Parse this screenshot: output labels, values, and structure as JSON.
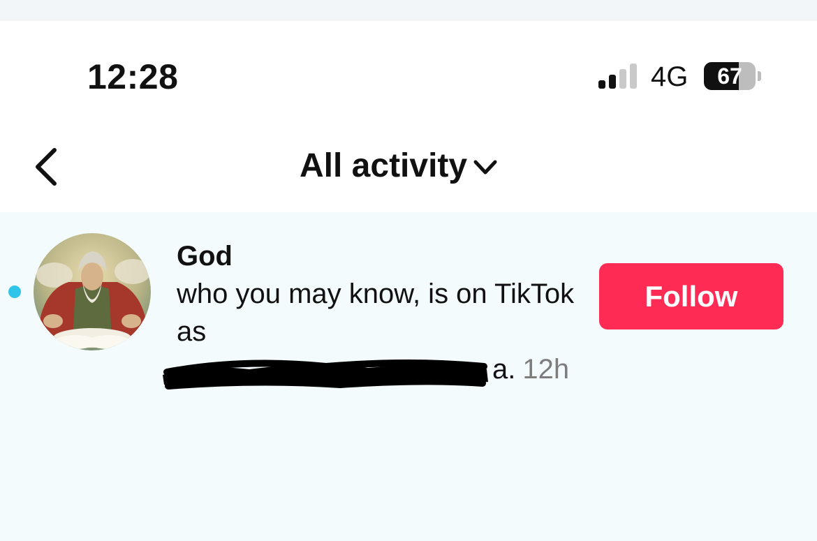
{
  "status_bar": {
    "time": "12:28",
    "network": "4G",
    "battery_percent": "67",
    "battery_level": 0.67,
    "signal_bars_active": 2
  },
  "nav": {
    "back_icon": "chevron-left-icon",
    "title": "All activity",
    "dropdown_icon": "chevron-down-icon"
  },
  "activity": {
    "items": [
      {
        "name": "God",
        "message": "who you may know, is on TikTok as",
        "handle_end": "a.",
        "timestamp": "12h",
        "unread": true,
        "unread_color": "#2fc4e8",
        "action_label": "Follow"
      }
    ]
  },
  "colors": {
    "accent": "#fe2c55",
    "row_background": "#f4fbfd",
    "timestamp": "#7d7d7d"
  }
}
